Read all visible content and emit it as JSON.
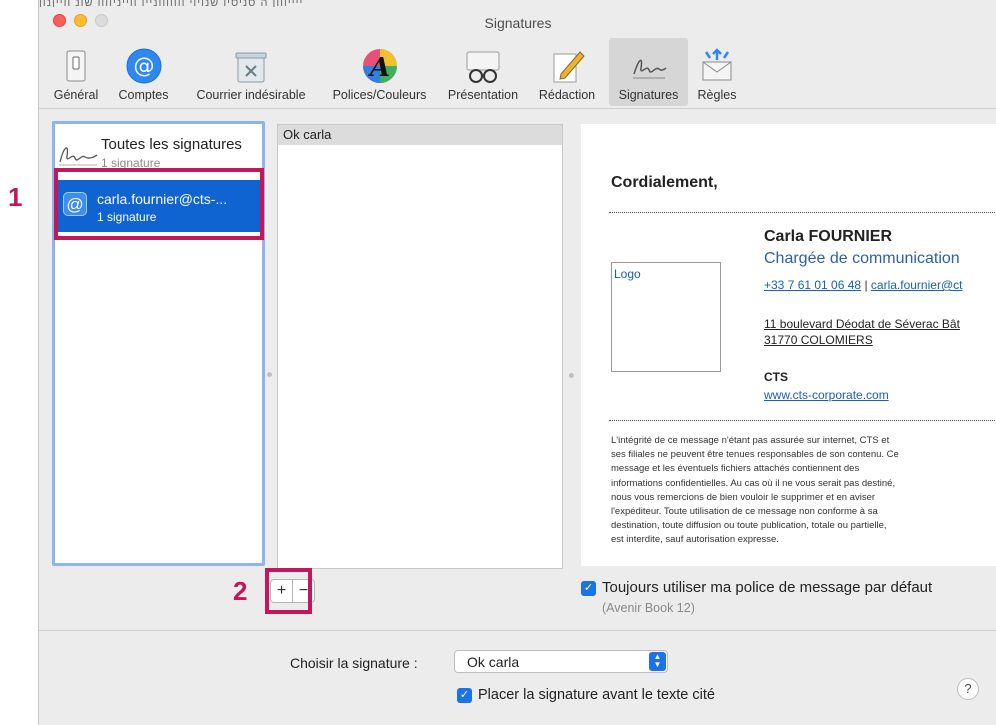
{
  "window": {
    "title": "Signatures"
  },
  "stray_text": "ייייווון ה סניסיו שנויוי ווווווונייו ווייניוווו שונ ווייןנון",
  "toolbar": {
    "items": [
      {
        "label": "Général",
        "icon": "switch-icon"
      },
      {
        "label": "Comptes",
        "icon": "at-icon"
      },
      {
        "label": "Courrier indésirable",
        "icon": "junk-mail-icon"
      },
      {
        "label": "Polices/Couleurs",
        "icon": "font-colors-icon"
      },
      {
        "label": "Présentation",
        "icon": "glasses-icon"
      },
      {
        "label": "Rédaction",
        "icon": "pencil-icon"
      },
      {
        "label": "Signatures",
        "icon": "signature-icon"
      },
      {
        "label": "Règles",
        "icon": "rules-icon"
      }
    ],
    "active": "Signatures"
  },
  "accounts": {
    "all": {
      "name": "Toutes les signatures",
      "count": "1 signature"
    },
    "selected": {
      "name": "carla.fournier@cts-...",
      "count": "1 signature"
    }
  },
  "signatures": {
    "items": [
      "Ok carla"
    ]
  },
  "preview": {
    "greeting": "Cordialement,",
    "logo": "Logo",
    "name": "Carla FOURNIER",
    "role": "Chargée de communication",
    "phone": "+33 7 61 01 06 48",
    "separator": "|",
    "email": "carla.fournier@ct",
    "address1": "11 boulevard Déodat de Séverac Bât",
    "address2": "31770 COLOMIERS",
    "company": "CTS",
    "website": "www.cts-corporate.com",
    "disclaimer_lines": [
      "L'intégrité de ce message n'étant pas assurée sur internet, CTS et",
      "ses filiales ne peuvent être tenues responsables de son contenu. Ce",
      "message et les éventuels fichiers attachés contiennent des",
      "informations confidentielles. Au cas où il ne vous serait pas destiné,",
      "nous vous remercions de bien vouloir le supprimer et en aviser",
      "l'expéditeur. Toute utilisation de ce message non conforme à sa",
      "destination, toute diffusion ou toute publication, totale ou partielle,",
      "est interdite, sauf autorisation expresse."
    ]
  },
  "controls": {
    "add": "+",
    "remove": "−",
    "always_font_label": "Toujours utiliser ma police de message par défaut",
    "always_font_checked": true,
    "font_desc": "(Avenir Book 12)",
    "choose_label": "Choisir la signature :",
    "choose_value": "Ok carla",
    "place_label": "Placer la signature avant le texte cité",
    "place_checked": true,
    "help": "?",
    "check_glyph": "✓"
  },
  "annotations": {
    "one": "1",
    "two": "2",
    "color": "#c2185b"
  }
}
